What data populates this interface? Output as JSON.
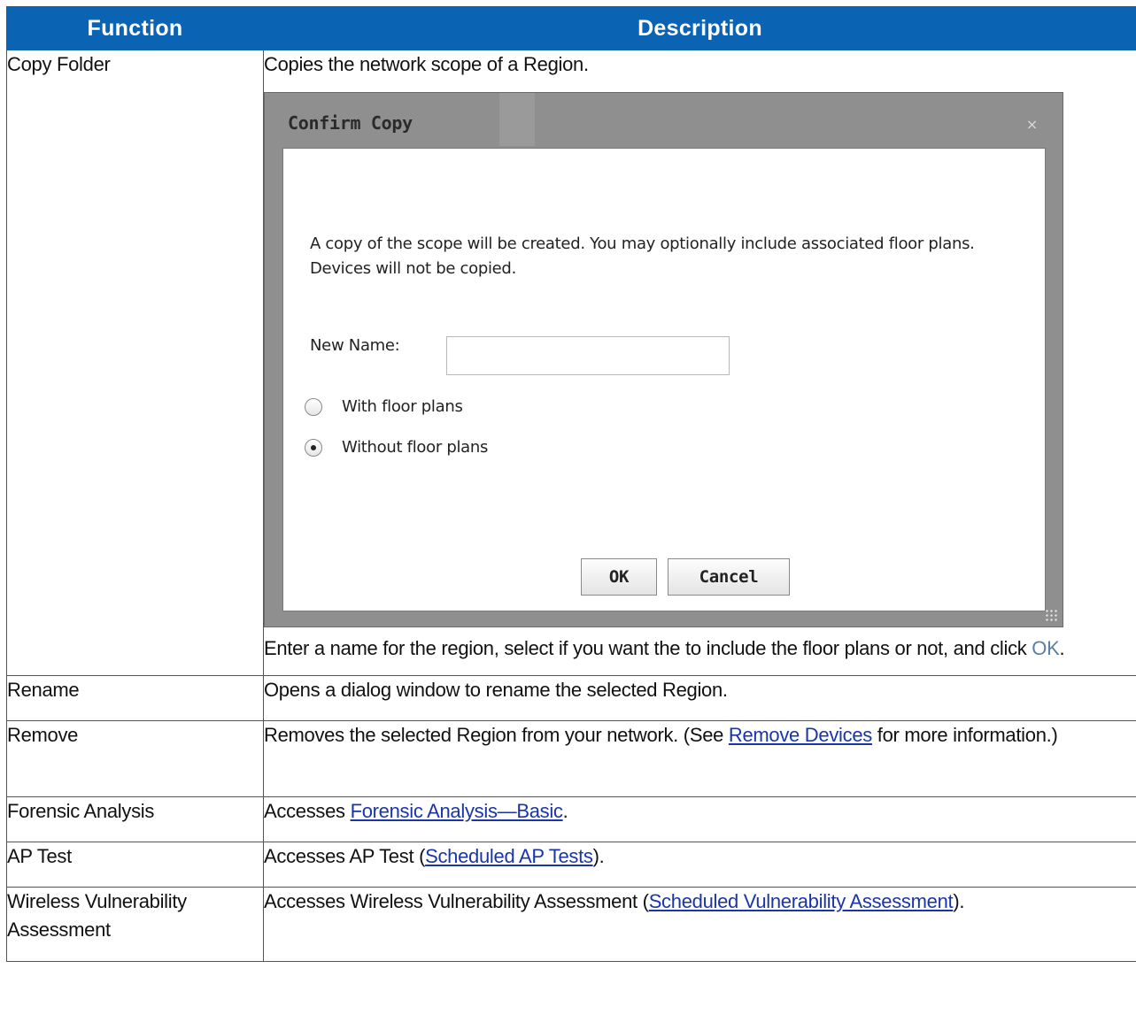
{
  "headers": {
    "function": "Function",
    "description": "Description"
  },
  "rows": {
    "copy": {
      "function": "Copy Folder",
      "description": "Copies the network scope of a Region.",
      "after_text": "Enter a name for the region, select if you want the to include the floor plans or not, and click ",
      "ok_ref": "OK",
      "after_end": "."
    },
    "rename": {
      "function": "Rename",
      "description": "Opens a dialog window to rename the selected Region."
    },
    "remove": {
      "function": "Remove",
      "pre": "Removes the selected Region from your network. (See ",
      "link": "Remove Devices",
      "post": " for more information.)"
    },
    "forensic": {
      "function": "Forensic Analysis",
      "pre": "Accesses ",
      "link": "Forensic Analysis—Basic",
      "post": "."
    },
    "aptest": {
      "function": "AP Test",
      "pre": "Accesses AP Test (",
      "link": "Scheduled AP Tests",
      "post": ")."
    },
    "wva": {
      "function": "Wireless Vulnerability Assessment",
      "pre": "Accesses Wireless Vulnerability Assessment (",
      "link": "Scheduled Vulnerability Assessment",
      "post": ")."
    }
  },
  "dialog": {
    "title": "Confirm Copy",
    "close": "×",
    "message": "A copy of the scope will be created. You may optionally include associated floor plans. Devices will not be copied.",
    "name_label": "New Name:",
    "name_value": "",
    "options": [
      {
        "label": "With floor plans",
        "selected": false
      },
      {
        "label": "Without floor plans",
        "selected": true
      }
    ],
    "ok_label": "OK",
    "cancel_label": "Cancel"
  },
  "colors": {
    "header_bg": "#0b63b3",
    "link": "#1a35a8",
    "ok_ref": "#5a7fa8"
  }
}
